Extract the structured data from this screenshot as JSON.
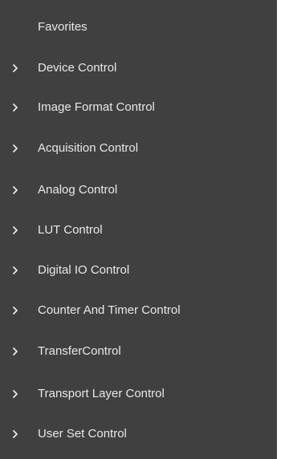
{
  "sidebar": {
    "favorites": {
      "label": "Favorites"
    },
    "items": [
      {
        "label": "Device Control",
        "icon": "chevron-right-icon"
      },
      {
        "label": "Image Format Control",
        "icon": "chevron-right-icon"
      },
      {
        "label": "Acquisition Control",
        "icon": "chevron-right-icon"
      },
      {
        "label": "Analog Control",
        "icon": "chevron-right-icon"
      },
      {
        "label": "LUT Control",
        "icon": "chevron-right-icon"
      },
      {
        "label": "Digital IO Control",
        "icon": "chevron-right-icon"
      },
      {
        "label": "Counter And Timer Control",
        "icon": "chevron-right-icon"
      },
      {
        "label": "TransferControl",
        "icon": "chevron-right-icon"
      },
      {
        "label": "Transport Layer Control",
        "icon": "chevron-right-icon"
      },
      {
        "label": "User Set Control",
        "icon": "chevron-right-icon"
      }
    ]
  },
  "colors": {
    "panel_background": "#404040",
    "text": "#e8e8e8",
    "page_background": "#ffffff"
  }
}
